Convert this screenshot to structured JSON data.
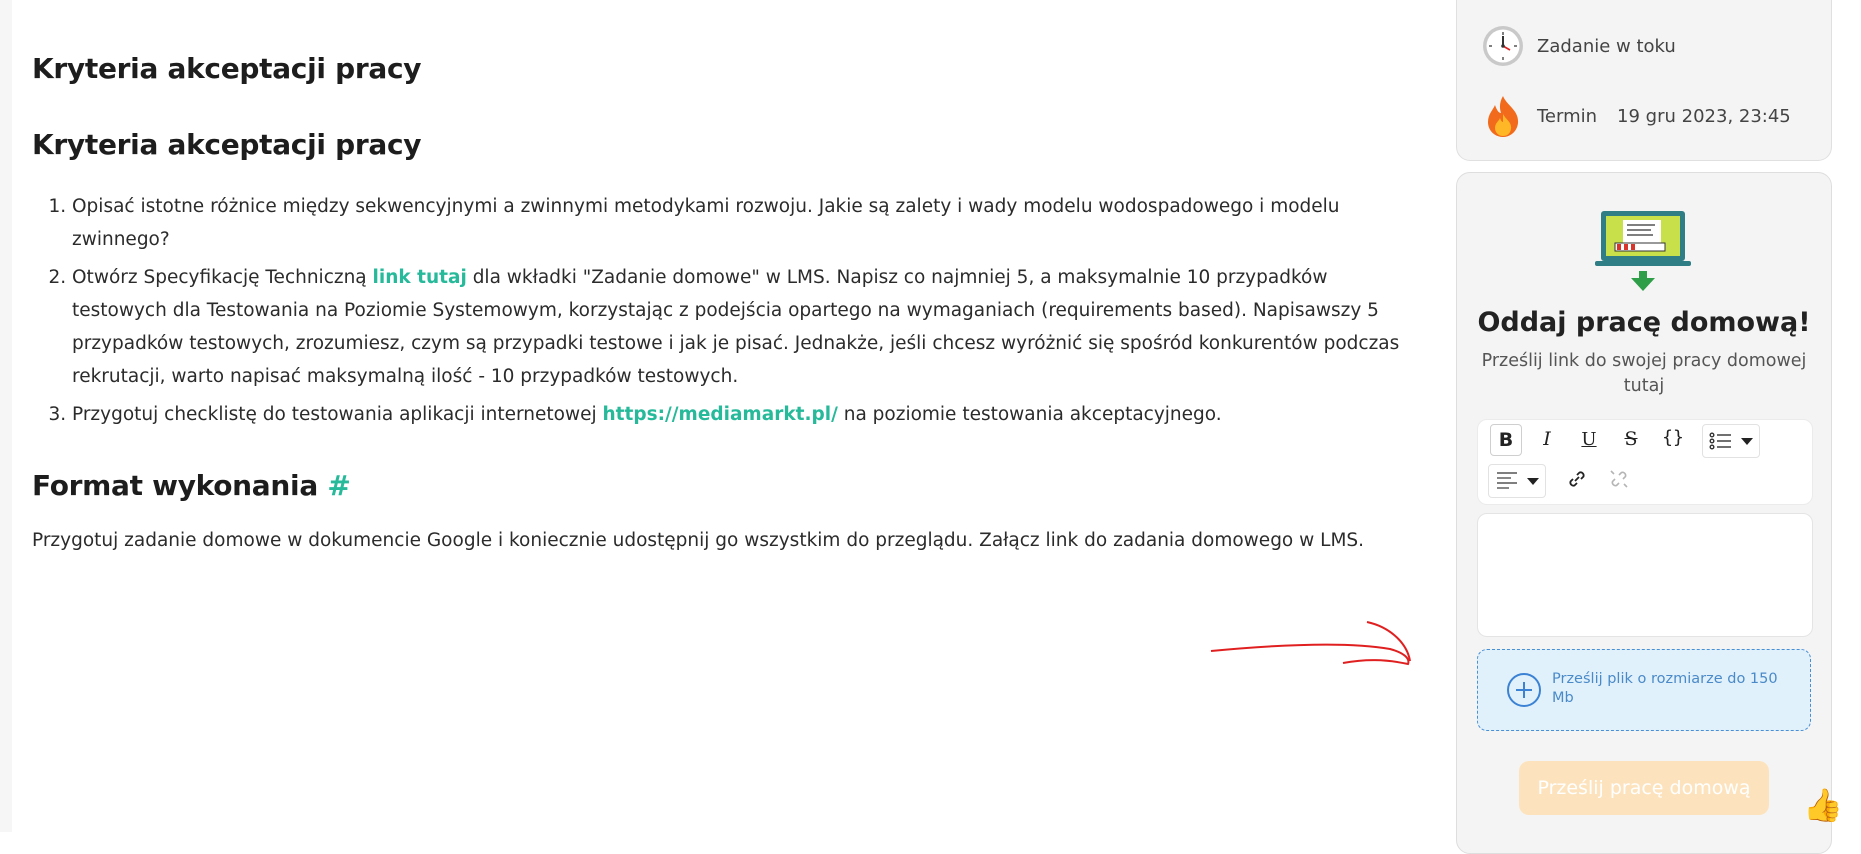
{
  "content": {
    "heading_1": "Kryteria akceptacji pracy",
    "heading_2": "Kryteria akceptacji pracy",
    "criteria": [
      {
        "text": "Opisać istotne różnice między sekwencyjnymi a zwinnymi metodykami rozwoju. Jakie są zalety i wady modelu wodospadowego i modelu zwinnego?"
      },
      {
        "before": "Otwórz Specyfikację Techniczną ",
        "link": "link tutaj",
        "after": " dla wkładki \"Zadanie domowe\" w LMS. Napisz co najmniej 5, a maksymalnie 10 przypadków testowych dla Testowania na Poziomie Systemowym, korzystając z podejścia opartego na wymaganiach (requirements based). Napisawszy 5 przypadków testowych, zrozumiesz, czym są przypadki testowe i jak je pisać. Jednakże, jeśli chcesz wyróżnić się spośród konkurentów podczas rekrutacji, warto napisać maksymalną ilość - 10 przypadków testowych."
      },
      {
        "before": "Przygotuj checklistę do testowania aplikacji internetowej ",
        "link": "https://mediamarkt.pl/",
        "after": " na poziomie testowania akceptacyjnego."
      }
    ],
    "format_heading": "Format wykonania",
    "format_hash": "#",
    "format_text": "Przygotuj zadanie domowe w dokumencie Google i koniecznie udostępnij go wszystkim do przeglądu. Załącz link do zadania domowego w LMS."
  },
  "status": {
    "state_label": "Zadanie w toku",
    "deadline_label": "Termin",
    "deadline_value": "19 gru 2023, 23:45"
  },
  "submission": {
    "title": "Oddaj pracę domową!",
    "subtitle": "Prześlij link do swojej pracy domowej tutaj",
    "toolbar": {
      "bold": "B",
      "italic": "I",
      "underline": "U",
      "strike": "S",
      "code": "{}"
    },
    "editor_value": "",
    "upload_label": "Prześlij plik o rozmiarze do 150 Mb",
    "submit_label": "Prześlij pracę domową"
  },
  "colors": {
    "accent_green": "#26b99a",
    "upload_blue": "#4a8fd6",
    "submit_disabled": "#fde3bd",
    "annotation_red": "#e02020"
  },
  "icons": [
    "clock-icon",
    "fire-icon",
    "laptop-illustration",
    "bold-icon",
    "italic-icon",
    "underline-icon",
    "strikethrough-icon",
    "code-icon",
    "list-icon",
    "align-icon",
    "link-icon",
    "unlink-icon",
    "plus-circle-icon",
    "thumbs-up-icon"
  ]
}
